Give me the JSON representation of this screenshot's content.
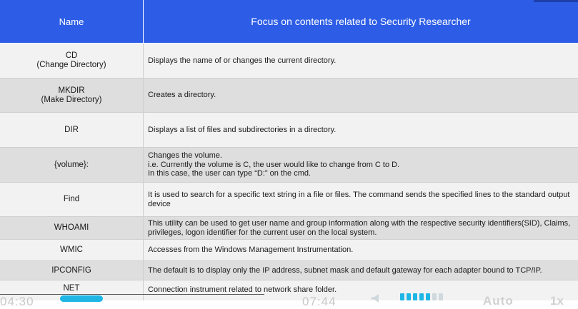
{
  "header": {
    "name_label": "Name",
    "focus_label": "Focus on contents related to Security Researcher"
  },
  "rows": [
    {
      "name": "CD\n(Change Directory)",
      "desc": "Displays the name of or changes the current directory."
    },
    {
      "name": "MKDIR\n(Make Directory)",
      "desc": "Creates a directory."
    },
    {
      "name": "DIR",
      "desc": "Displays a list of files and subdirectories in a directory."
    },
    {
      "name": "{volume}:",
      "desc": "Changes the volume.\ni.e. Currently the volume is C, the user would like to change from C to D.\nIn this case, the user can type “D:” on the cmd."
    },
    {
      "name": "Find",
      "desc": "It is used to search for a specific text string in a file or files. The command sends the specified lines to the standard output device"
    },
    {
      "name": "WHOAMI",
      "desc": "This utility can be used to get user name and group information along with the respective security identifiers(SID), Claims, privileges, logon identifier for the current user on the local system."
    },
    {
      "name": "WMIC",
      "desc": "Accesses from the Windows Management Instrumentation."
    },
    {
      "name": "IPCONFIG",
      "desc": "The default is to display only the IP address, subnet mask and default gateway for each adapter bound to TCP/IP."
    },
    {
      "name": "NET",
      "desc": "Connection instrument related to network share folder."
    }
  ],
  "video": {
    "elapsed": "04:30",
    "duration": "07:44",
    "quality": "Auto",
    "speed": "1x",
    "progress": 0.58,
    "colors": {
      "accent": "#1fb6e6",
      "header": "#2d5de6"
    }
  }
}
